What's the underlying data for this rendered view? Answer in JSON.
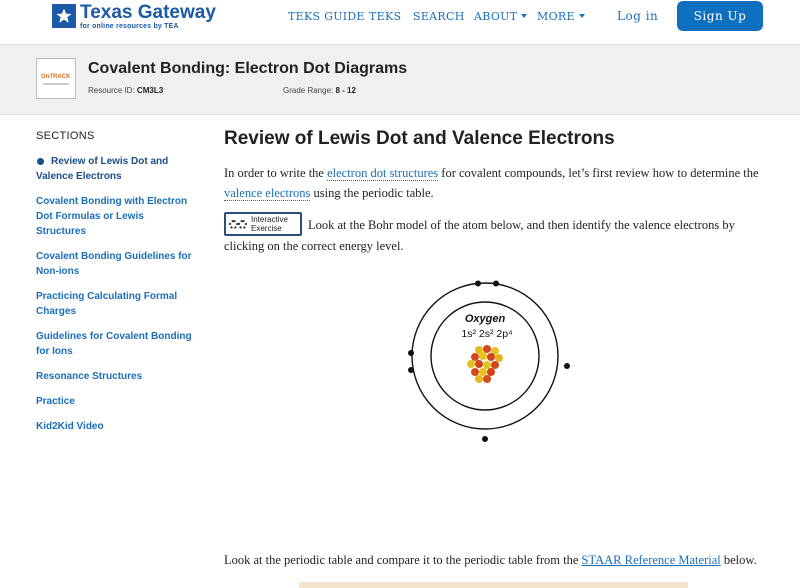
{
  "nav": {
    "logo_title": "Texas Gateway",
    "logo_sub": "for online resources by TEA",
    "links": [
      {
        "label": "TEKS GUIDE",
        "dropdown": false
      },
      {
        "label": "TEKS",
        "dropdown": false
      },
      {
        "label": "SEARCH",
        "dropdown": false
      },
      {
        "label": "ABOUT",
        "dropdown": true
      },
      {
        "label": "MORE",
        "dropdown": true
      }
    ],
    "login": "Log in",
    "signup": "Sign Up",
    "accent": "#1070c0"
  },
  "resource": {
    "logo_text": "OnTRACK",
    "title": "Covalent Bonding: Electron Dot Diagrams",
    "id_label": "Resource ID:",
    "id_value": "CM3L3",
    "grade_label": "Grade Range:",
    "grade_value": "8 - 12"
  },
  "sidebar": {
    "title": "SECTIONS",
    "items": [
      {
        "line1": "Review of Lewis Dot and",
        "line2": "Valence Electrons",
        "active": true
      },
      {
        "line1": "Covalent Bonding with Electron",
        "line2": "Dot Formulas or Lewis",
        "line3": "Structures",
        "active": false
      },
      {
        "line1": "Covalent Bonding Guidelines for",
        "line2": "Non-ions",
        "active": false
      },
      {
        "line1": "Practicing Calculating Formal",
        "line2": "Charges",
        "active": false
      },
      {
        "line1": "Guidelines for Covalent Bonding",
        "line2": "for Ions",
        "active": false
      },
      {
        "line1": "Resonance Structures",
        "active": false
      },
      {
        "line1": "Practice",
        "active": false
      },
      {
        "line1": "Kid2Kid Video",
        "active": false
      }
    ]
  },
  "main": {
    "heading": "Review of Lewis Dot and Valence Electrons",
    "p1_a": "In order to write the ",
    "p1_link1": "electron dot structures",
    "p1_b": " for covalent compounds, let’s first review how to determine the",
    "p1_link2": "valence electrons",
    "p1_c": " using the periodic table.",
    "ie_line1": "Interactive",
    "ie_line2": "Exercise",
    "p2_a": "Look at the Bohr model of the atom below, and then identify the valence electrons by",
    "p2_b": "clicking on the correct energy level.",
    "atom_name": "Oxygen",
    "atom_config": "1s² 2s² 2p⁴",
    "p3_a": "Look at the periodic table and compare it to the periodic table from the ",
    "p3_link": "STAAR Reference Material",
    "p3_b": " below."
  }
}
